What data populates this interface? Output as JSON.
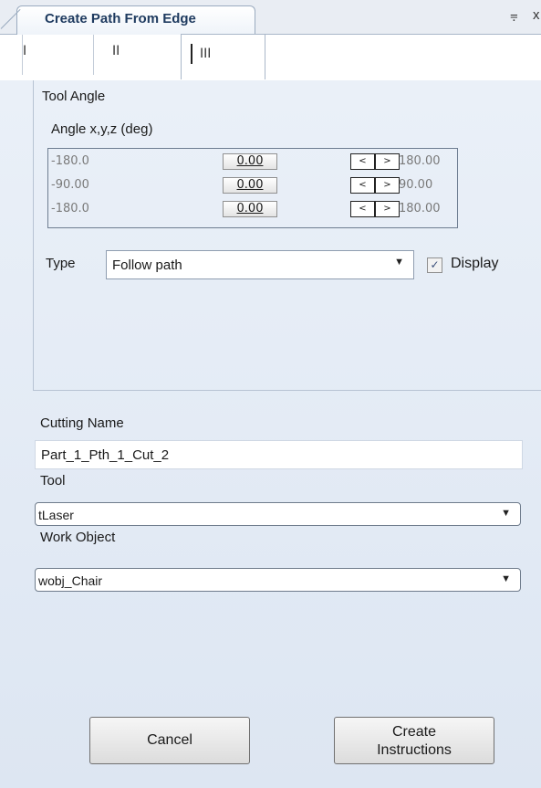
{
  "window": {
    "title": "Create Path From Edge",
    "pin_glyph": "⩦",
    "close_glyph": "x"
  },
  "subtabs": [
    "I",
    "II",
    "III"
  ],
  "tool_angle": {
    "group_title": "Tool Angle",
    "angle_label": "Angle x,y,z (deg)",
    "rows": [
      {
        "min": "-180.0",
        "value": "0.00",
        "max": "180.00"
      },
      {
        "min": "-90.00",
        "value": "0.00",
        "max": "90.00"
      },
      {
        "min": "-180.0",
        "value": "0.00",
        "max": "180.00"
      }
    ],
    "btn_left_glyph": "<",
    "btn_right_glyph": ">"
  },
  "type": {
    "label": "Type",
    "selected": "Follow path",
    "display_label": "Display",
    "display_checked": true
  },
  "cutting": {
    "label": "Cutting Name",
    "value": "Part_1_Pth_1_Cut_2"
  },
  "tool": {
    "label": "Tool",
    "selected": "tLaser"
  },
  "work_object": {
    "label": "Work Object",
    "selected": "wobj_Chair"
  },
  "buttons": {
    "cancel": "Cancel",
    "create": "Create\nInstructions"
  }
}
